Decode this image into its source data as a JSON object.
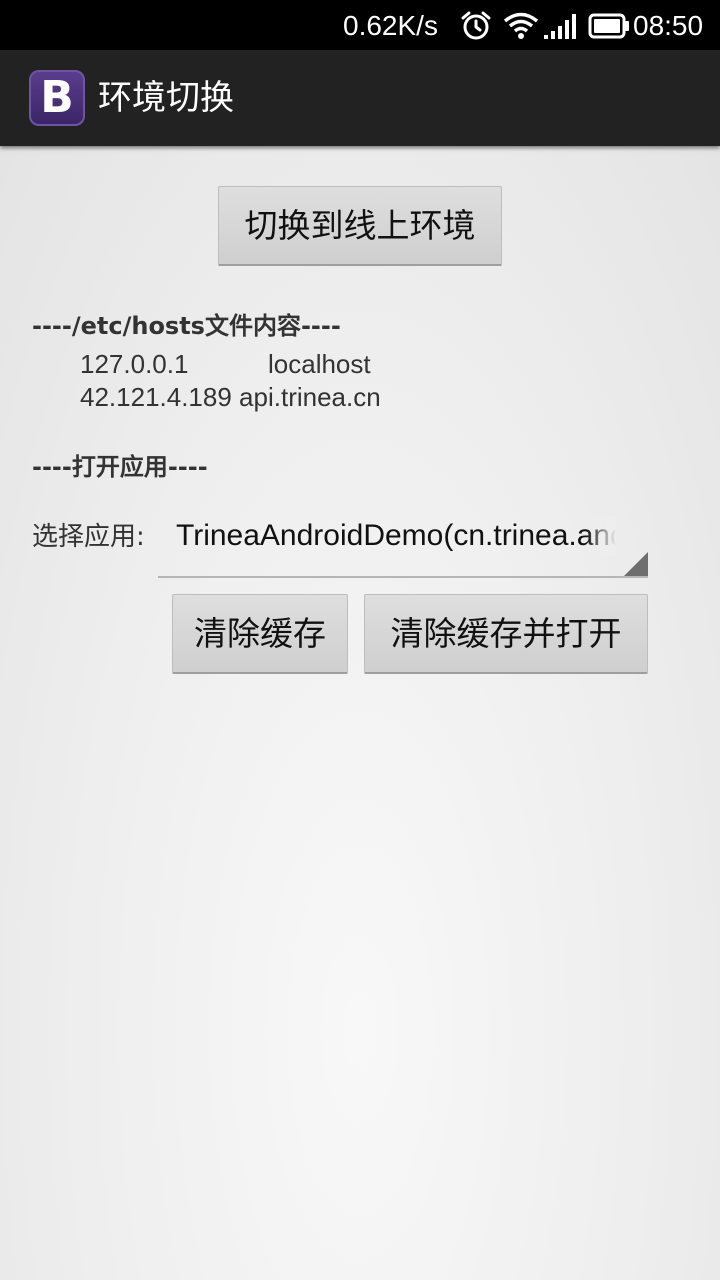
{
  "status_bar": {
    "speed": "0.62K/s",
    "time": "08:50",
    "icons": [
      "alarm-icon",
      "wifi-icon",
      "signal-icon",
      "battery-icon"
    ]
  },
  "action_bar": {
    "app_icon_letter": "B",
    "title": "环境切换"
  },
  "main": {
    "switch_button": "切换到线上环境",
    "hosts_title": "----/etc/hosts文件内容----",
    "hosts": [
      {
        "ip": "127.0.0.1",
        "host": "localhost"
      },
      {
        "ip": "42.121.4.189",
        "host": "api.trinea.cn"
      }
    ],
    "open_title": "----打开应用----",
    "select_label": "选择应用:",
    "selected_app": "TrineaAndroidDemo(cn.trinea.android.demo)",
    "clear_cache_button": "清除缓存",
    "clear_cache_open_button": "清除缓存并打开"
  },
  "colors": {
    "status_bar_bg": "#000000",
    "action_bar_bg": "#222222",
    "app_icon_bg": "#4a3278",
    "content_bg": "#eeeeee",
    "button_bg": "#d6d6d6"
  }
}
